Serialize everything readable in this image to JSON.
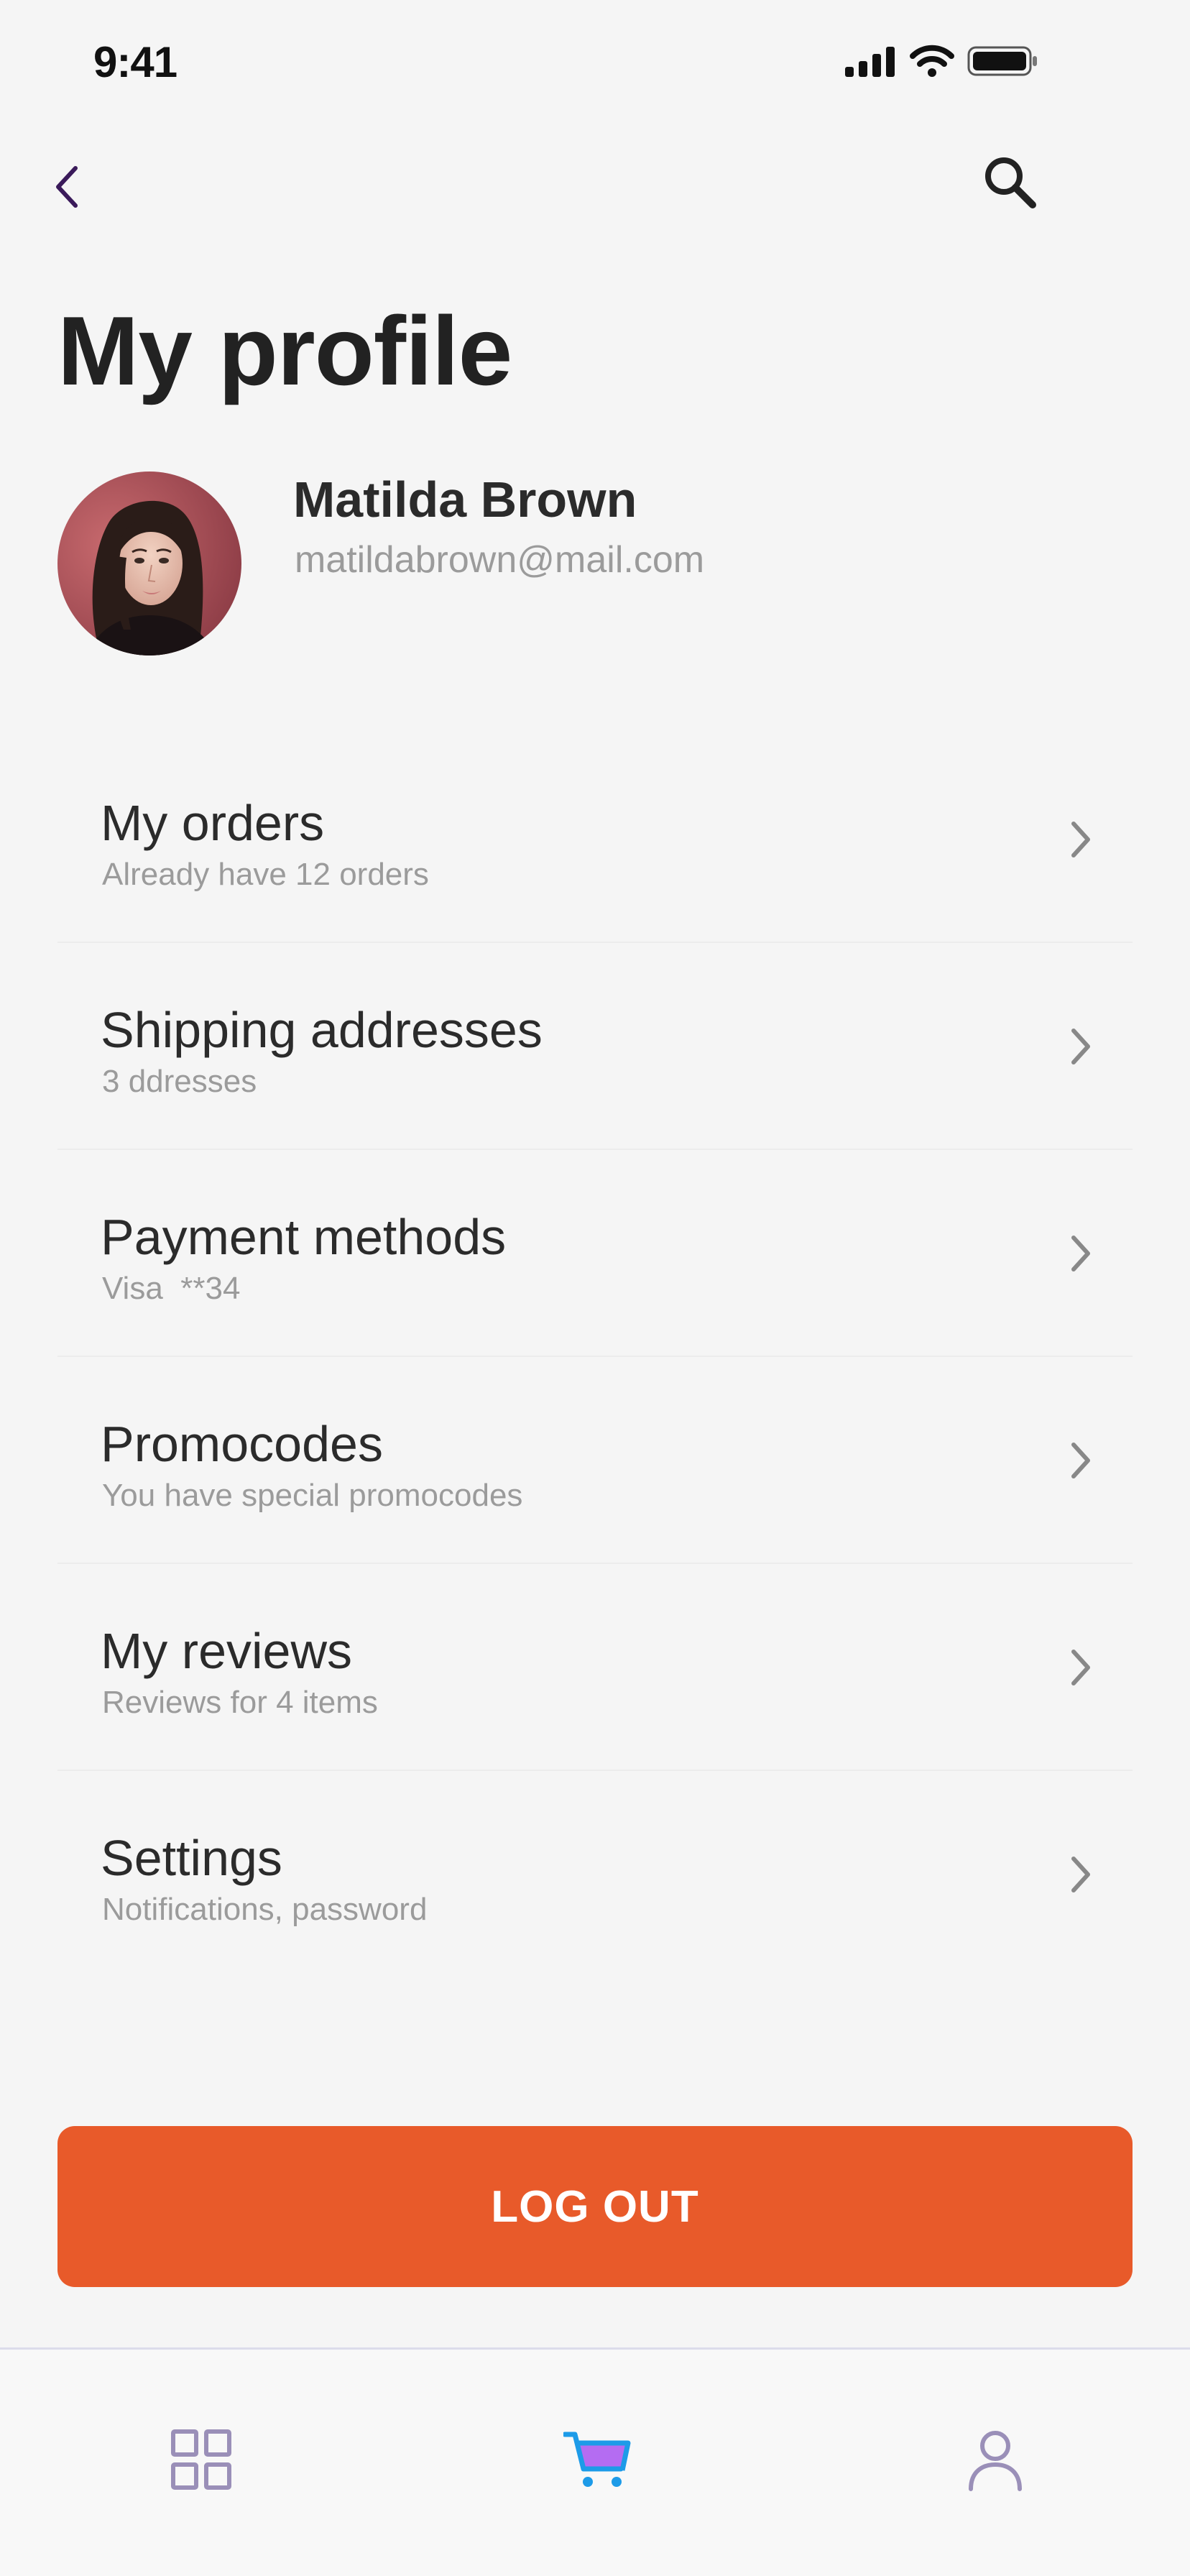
{
  "status_bar": {
    "time": "9:41",
    "icons": [
      "cellular-signal-icon",
      "wifi-icon",
      "battery-icon"
    ]
  },
  "nav": {
    "back_icon": "chevron-left-icon",
    "search_icon": "search-icon"
  },
  "page": {
    "title": "My profile"
  },
  "profile": {
    "name": "Matilda Brown",
    "email": "matildabrown@mail.com"
  },
  "menu": {
    "items": [
      {
        "title": "My orders",
        "subtitle": "Already have 12 orders"
      },
      {
        "title": "Shipping addresses",
        "subtitle": "3 ddresses"
      },
      {
        "title": "Payment methods",
        "subtitle": "Visa  **34"
      },
      {
        "title": "Promocodes",
        "subtitle": "You have special promocodes"
      },
      {
        "title": "My reviews",
        "subtitle": "Reviews for 4 items"
      },
      {
        "title": "Settings",
        "subtitle": "Notifications, password"
      }
    ]
  },
  "logout": {
    "label": "LOG OUT"
  },
  "bottom_nav": {
    "items": [
      {
        "icon": "grid-icon",
        "active": false
      },
      {
        "icon": "cart-icon",
        "active": true
      },
      {
        "icon": "user-icon",
        "active": false
      }
    ]
  },
  "colors": {
    "background": "#f5f5f5",
    "accent": "#e85a2a",
    "nav_icon": "#9a8fb8",
    "cart_blue": "#1d9be8",
    "cart_purple": "#b46cf2",
    "back_chevron": "#3a1a5a"
  }
}
